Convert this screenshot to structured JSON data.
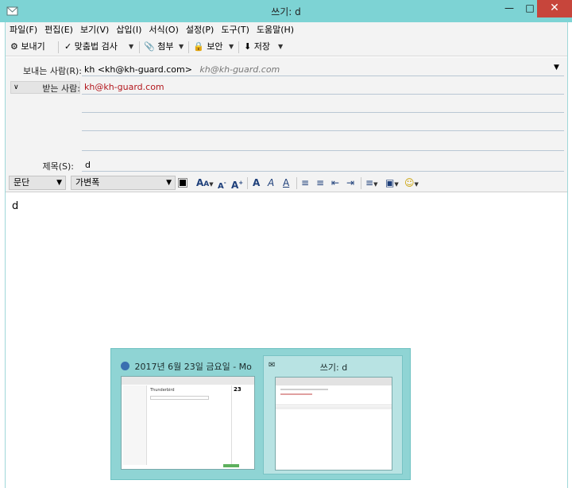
{
  "window": {
    "title": "쓰기: d"
  },
  "menu": [
    "파일(F)",
    "편집(E)",
    "보기(V)",
    "삽입(I)",
    "서식(O)",
    "설정(P)",
    "도구(T)",
    "도움말(H)"
  ],
  "toolbar": {
    "send": "보내기",
    "spell": "맞춤법 검사",
    "attach": "첨부",
    "security": "보안",
    "save": "저장"
  },
  "headers": {
    "from_label": "보내는 사람(R):",
    "from_value": "kh <kh@kh-guard.com>",
    "from_identity": "kh@kh-guard.com",
    "to_label": "받는 사람:",
    "to_value": "kh@kh-guard.com",
    "subject_label": "제목(S):",
    "subject_value": "d"
  },
  "format": {
    "paragraph": "문단",
    "font": "가변폭",
    "letters": [
      "A",
      "A",
      "A",
      "A"
    ]
  },
  "body": {
    "text": "d"
  },
  "switcher": {
    "items": [
      {
        "title": "2017년 6월 23일 금요일 - Mo..."
      },
      {
        "title": "쓰기: d"
      }
    ],
    "thumb_app_title": "Thunderbird",
    "thumb_date": "23"
  },
  "colors": {
    "titlebar": "#7dd3d4",
    "close_button": "#c7453b",
    "recipient": "#b3171d"
  }
}
